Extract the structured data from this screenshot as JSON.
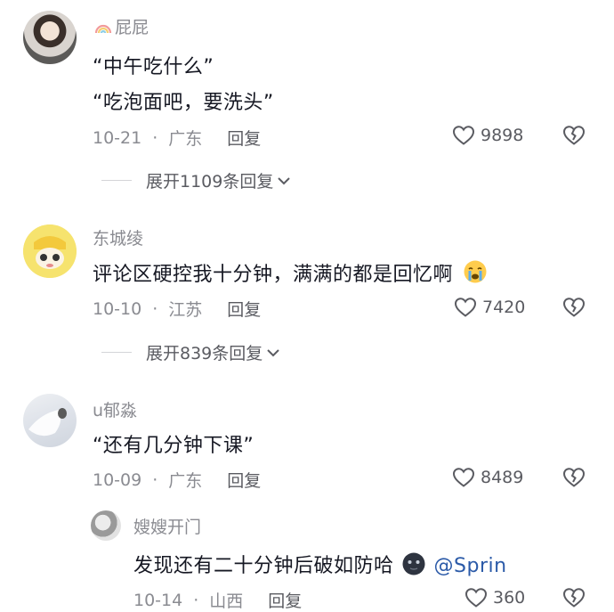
{
  "comments": [
    {
      "user": "屁屁",
      "user_prefix_icon": "rainbow-icon",
      "lines": [
        "“中午吃什么”",
        "“吃泡面吧，要洗头”"
      ],
      "date": "10-21",
      "location": "广东",
      "reply_label": "回复",
      "likes": "9898",
      "expand_label": "展开1109条回复"
    },
    {
      "user": "东城绫",
      "lines": [
        "评论区硬控我十分钟，满满的都是回忆啊"
      ],
      "emoji": "crying-emoji",
      "date": "10-10",
      "location": "江苏",
      "reply_label": "回复",
      "likes": "7420",
      "expand_label": "展开839条回复"
    },
    {
      "user": "u郁淼",
      "lines": [
        "“还有几分钟下课”"
      ],
      "date": "10-09",
      "location": "广东",
      "reply_label": "回复",
      "likes": "8489"
    }
  ],
  "reply": {
    "user": "嫂嫂开门",
    "text": "发现还有二十分钟后破如防哈",
    "emoji": "dark-face-emoji",
    "mention": "@Sprin",
    "date": "10-14",
    "location": "山西",
    "reply_label": "回复",
    "likes": "360"
  },
  "colors": {
    "text": "#161823",
    "secondary": "#8a8b91",
    "mention": "#2b5aa8",
    "background": "#ffffff"
  }
}
